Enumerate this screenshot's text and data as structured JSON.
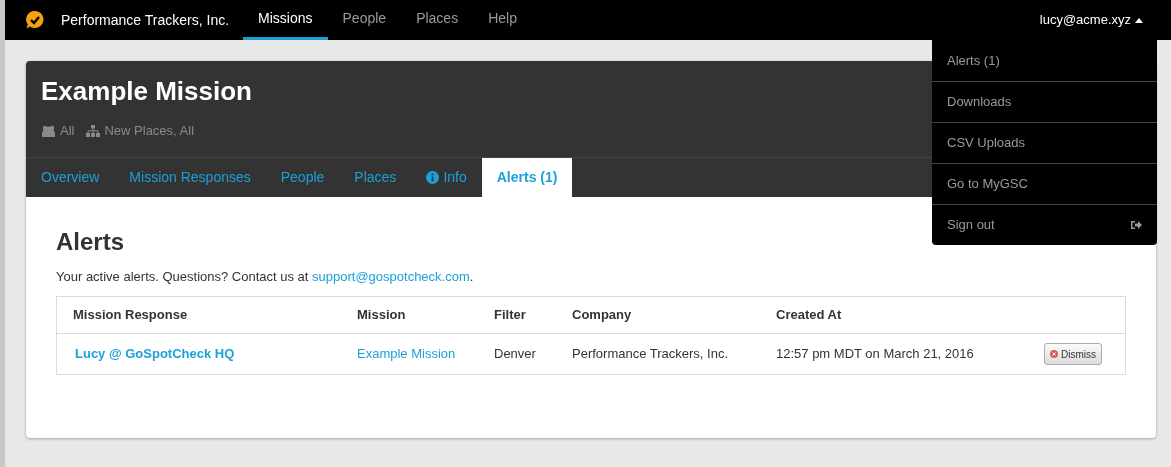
{
  "navbar": {
    "brand": "Performance Trackers, Inc.",
    "items": [
      {
        "label": "Missions",
        "selected": true
      },
      {
        "label": "People",
        "selected": false
      },
      {
        "label": "Places",
        "selected": false
      },
      {
        "label": "Help",
        "selected": false
      }
    ],
    "user": "lucy@acme.xyz",
    "menu": {
      "expanded": true,
      "items": [
        {
          "label": "Alerts (1)",
          "kind": "plain"
        },
        {
          "label": "Downloads",
          "kind": "plain"
        },
        {
          "label": "CSV Uploads",
          "kind": "plain"
        },
        {
          "label": "Go to MyGSC",
          "kind": "plain"
        },
        {
          "label": "Sign out",
          "kind": "signout"
        }
      ]
    }
  },
  "mission": {
    "title": "Example Mission",
    "people": "All",
    "places": "New Places, All"
  },
  "tabs": [
    {
      "label": "Overview",
      "selected": false,
      "kind": "plain"
    },
    {
      "label": "Mission Responses",
      "selected": false,
      "kind": "plain"
    },
    {
      "label": "People",
      "selected": false,
      "kind": "plain"
    },
    {
      "label": "Places",
      "selected": false,
      "kind": "plain"
    },
    {
      "label": "Info",
      "selected": false,
      "kind": "info"
    },
    {
      "label": "Alerts (1)",
      "selected": true,
      "kind": "plain"
    }
  ],
  "alerts": {
    "heading": "Alerts",
    "intro": "Your active alerts. Questions? Contact us at ",
    "email": "support@gospotcheck.com",
    "intro_end": ".",
    "table": {
      "columns": [
        "Mission Response",
        "Mission",
        "Filter",
        "Company",
        "Created At"
      ],
      "rows": [
        {
          "mission_response": "Lucy @ GoSpotCheck HQ",
          "mission": "Example Mission",
          "filter": "Denver",
          "company": "Performance Trackers, Inc.",
          "created_at": "12:57 pm MDT on March 21, 2016",
          "action": "Dismiss"
        }
      ]
    }
  }
}
